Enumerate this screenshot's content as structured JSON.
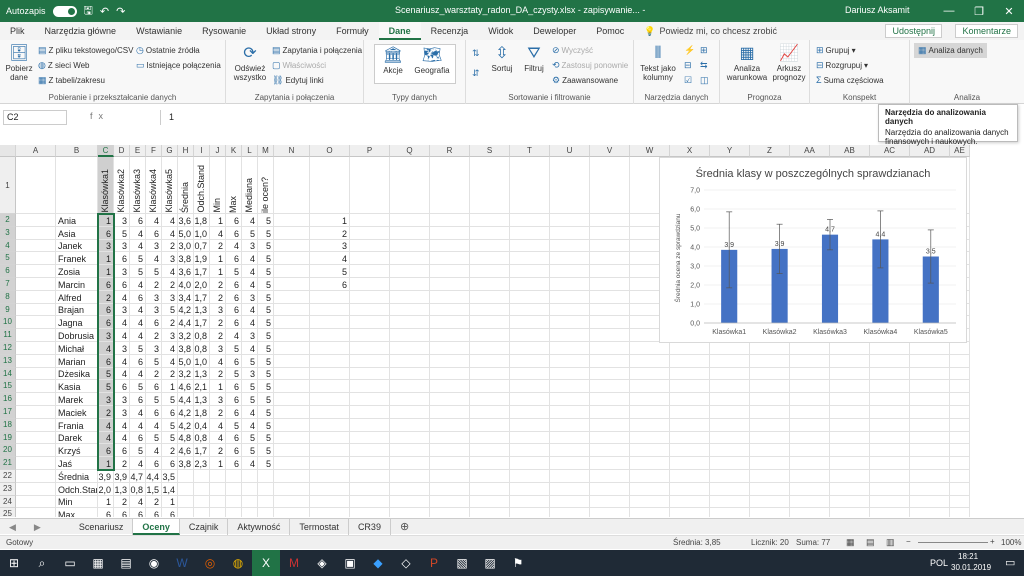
{
  "titlebar": {
    "autosave": "Autozapis",
    "doc_title": "Scenariusz_warsztaty_radon_DA_czysty.xlsx - zapisywanie... -",
    "user": "Dariusz Aksamit"
  },
  "tabs": [
    "Plik",
    "Narzędzia główne",
    "Wstawianie",
    "Rysowanie",
    "Układ strony",
    "Formuły",
    "Dane",
    "Recenzja",
    "Widok",
    "Deweloper",
    "Pomoc"
  ],
  "active_tab": "Dane",
  "tellme": "Powiedz mi, co chcesz zrobić",
  "share": "Udostępnij",
  "comments": "Komentarze",
  "ribbon": {
    "get_data": "Pobierz dane",
    "from_csv": "Z pliku tekstowego/CSV",
    "from_web": "Z sieci Web",
    "from_table": "Z tabeli/zakresu",
    "recent": "Ostatnie źródła",
    "existing": "Istniejące połączenia",
    "group1": "Pobieranie i przekształcanie danych",
    "refresh_all": "Odśwież wszystko",
    "queries": "Zapytania i połączenia",
    "properties": "Właściwości",
    "edit_links": "Edytuj linki",
    "group2": "Zapytania i połączenia",
    "stocks": "Akcje",
    "geography": "Geografia",
    "group3": "Typy danych",
    "sort": "Sortuj",
    "filter": "Filtruj",
    "clear": "Wyczyść",
    "reapply": "Zastosuj ponownie",
    "advanced": "Zaawansowane",
    "group4": "Sortowanie i filtrowanie",
    "text_to_cols": "Tekst jako kolumny",
    "group5": "Narzędzia danych",
    "whatif": "Analiza warunkowa",
    "forecast": "Arkusz prognozy",
    "group6": "Prognoza",
    "group_btn": "Grupuj",
    "ungroup_btn": "Rozgrupuj",
    "subtotal": "Suma częściowa",
    "group7": "Konspekt",
    "analysis": "Analiza danych",
    "group8": "Analiza"
  },
  "tooltip": {
    "title": "Narzędzia do analizowania danych",
    "body": "Narzędzia do analizowania danych finansowych i naukowych."
  },
  "formula": {
    "namebox": "C2",
    "fx": "fx",
    "content": "1"
  },
  "columns": [
    "A",
    "B",
    "C",
    "D",
    "E",
    "F",
    "G",
    "H",
    "I",
    "J",
    "K",
    "L",
    "M",
    "N",
    "O",
    "P",
    "Q",
    "R",
    "S",
    "T",
    "U",
    "V",
    "W",
    "X",
    "Y",
    "Z",
    "AA",
    "AB",
    "AC",
    "AD",
    "AE"
  ],
  "headers": [
    "Klasówka1",
    "Klasówka2",
    "Klasówka3",
    "Klasówka4",
    "Klasówka5",
    "Średnia",
    "Odch.Stand",
    "Min",
    "Max",
    "Mediana",
    "ile ocen?"
  ],
  "students": [
    {
      "name": "Ania",
      "v": [
        "1",
        "3",
        "6",
        "4",
        "4",
        "3,6",
        "1,8",
        "1",
        "6",
        "4",
        "5"
      ]
    },
    {
      "name": "Asia",
      "v": [
        "6",
        "5",
        "4",
        "6",
        "4",
        "5,0",
        "1,0",
        "4",
        "6",
        "5",
        "5"
      ]
    },
    {
      "name": "Janek",
      "v": [
        "3",
        "3",
        "4",
        "3",
        "2",
        "3,0",
        "0,7",
        "2",
        "4",
        "3",
        "5"
      ]
    },
    {
      "name": "Franek",
      "v": [
        "1",
        "6",
        "5",
        "4",
        "3",
        "3,8",
        "1,9",
        "1",
        "6",
        "4",
        "5"
      ]
    },
    {
      "name": "Zosia",
      "v": [
        "1",
        "3",
        "5",
        "5",
        "4",
        "3,6",
        "1,7",
        "1",
        "5",
        "4",
        "5"
      ]
    },
    {
      "name": "Marcin",
      "v": [
        "6",
        "6",
        "4",
        "2",
        "2",
        "4,0",
        "2,0",
        "2",
        "6",
        "4",
        "5"
      ]
    },
    {
      "name": "Alfred",
      "v": [
        "2",
        "4",
        "6",
        "3",
        "3",
        "3,4",
        "1,7",
        "2",
        "6",
        "3",
        "5"
      ]
    },
    {
      "name": "Brajan",
      "v": [
        "6",
        "3",
        "4",
        "3",
        "5",
        "4,2",
        "1,3",
        "3",
        "6",
        "4",
        "5"
      ]
    },
    {
      "name": "Jagna",
      "v": [
        "6",
        "4",
        "4",
        "6",
        "2",
        "4,4",
        "1,7",
        "2",
        "6",
        "4",
        "5"
      ]
    },
    {
      "name": "Dobrusia",
      "v": [
        "3",
        "4",
        "4",
        "2",
        "3",
        "3,2",
        "0,8",
        "2",
        "4",
        "3",
        "5"
      ]
    },
    {
      "name": "Michał",
      "v": [
        "4",
        "3",
        "5",
        "3",
        "4",
        "3,8",
        "0,8",
        "3",
        "5",
        "4",
        "5"
      ]
    },
    {
      "name": "Marian",
      "v": [
        "6",
        "4",
        "6",
        "5",
        "4",
        "5,0",
        "1,0",
        "4",
        "6",
        "5",
        "5"
      ]
    },
    {
      "name": "Dżesika",
      "v": [
        "5",
        "4",
        "4",
        "2",
        "2",
        "3,2",
        "1,3",
        "2",
        "5",
        "3",
        "5"
      ]
    },
    {
      "name": "Kasia",
      "v": [
        "5",
        "6",
        "5",
        "6",
        "1",
        "4,6",
        "2,1",
        "1",
        "6",
        "5",
        "5"
      ]
    },
    {
      "name": "Marek",
      "v": [
        "3",
        "3",
        "6",
        "5",
        "5",
        "4,4",
        "1,3",
        "3",
        "6",
        "5",
        "5"
      ]
    },
    {
      "name": "Maciek",
      "v": [
        "2",
        "3",
        "4",
        "6",
        "6",
        "4,2",
        "1,8",
        "2",
        "6",
        "4",
        "5"
      ]
    },
    {
      "name": "Frania",
      "v": [
        "4",
        "4",
        "4",
        "4",
        "5",
        "4,2",
        "0,4",
        "4",
        "5",
        "4",
        "5"
      ]
    },
    {
      "name": "Darek",
      "v": [
        "4",
        "4",
        "6",
        "5",
        "5",
        "4,8",
        "0,8",
        "4",
        "6",
        "5",
        "5"
      ]
    },
    {
      "name": "Krzyś",
      "v": [
        "6",
        "6",
        "5",
        "4",
        "2",
        "4,6",
        "1,7",
        "2",
        "6",
        "5",
        "5"
      ]
    },
    {
      "name": "Jaś",
      "v": [
        "1",
        "2",
        "4",
        "6",
        "6",
        "3,8",
        "2,3",
        "1",
        "6",
        "4",
        "5"
      ]
    }
  ],
  "summary": [
    {
      "label": "Średnia",
      "v": [
        "3,9",
        "3,9",
        "4,7",
        "4,4",
        "3,5"
      ]
    },
    {
      "label": "Odch.Stand",
      "v": [
        "2,0",
        "1,3",
        "0,8",
        "1,5",
        "1,4"
      ]
    },
    {
      "label": "Min",
      "v": [
        "1",
        "2",
        "4",
        "2",
        "1"
      ]
    },
    {
      "label": "Max",
      "v": [
        "6",
        "6",
        "6",
        "6",
        "6"
      ]
    }
  ],
  "col_o": [
    "1",
    "2",
    "3",
    "4",
    "5",
    "6"
  ],
  "chart_data": {
    "type": "bar",
    "title": "Średnia klasy w poszczególnych sprawdzianach",
    "ylabel": "Średnia ocena ze sprawdzianu",
    "categories": [
      "Klasówka1",
      "Klasówka2",
      "Klasówka3",
      "Klasówka4",
      "Klasówka5"
    ],
    "values": [
      3.85,
      3.9,
      4.65,
      4.4,
      3.5
    ],
    "data_labels": [
      "3,9",
      "3,9",
      "4,7",
      "4,4",
      "3,5"
    ],
    "errors": [
      2.0,
      1.3,
      0.8,
      1.5,
      1.4
    ],
    "ylim": [
      0,
      7
    ],
    "yticks": [
      "0,0",
      "1,0",
      "2,0",
      "3,0",
      "4,0",
      "5,0",
      "6,0",
      "7,0"
    ],
    "bar_color": "#4472c4"
  },
  "sheets": [
    "Scenariusz",
    "Oceny",
    "Czajnik",
    "Aktywność",
    "Termostat",
    "CR39"
  ],
  "active_sheet": "Oceny",
  "status": {
    "ready": "Gotowy",
    "avg": "Średnia: 3,85",
    "count": "Licznik: 20",
    "sum": "Suma: 77",
    "zoom": "100%"
  },
  "taskbar": {
    "lang": "POL",
    "time": "18:21",
    "date": "30.01.2019"
  }
}
